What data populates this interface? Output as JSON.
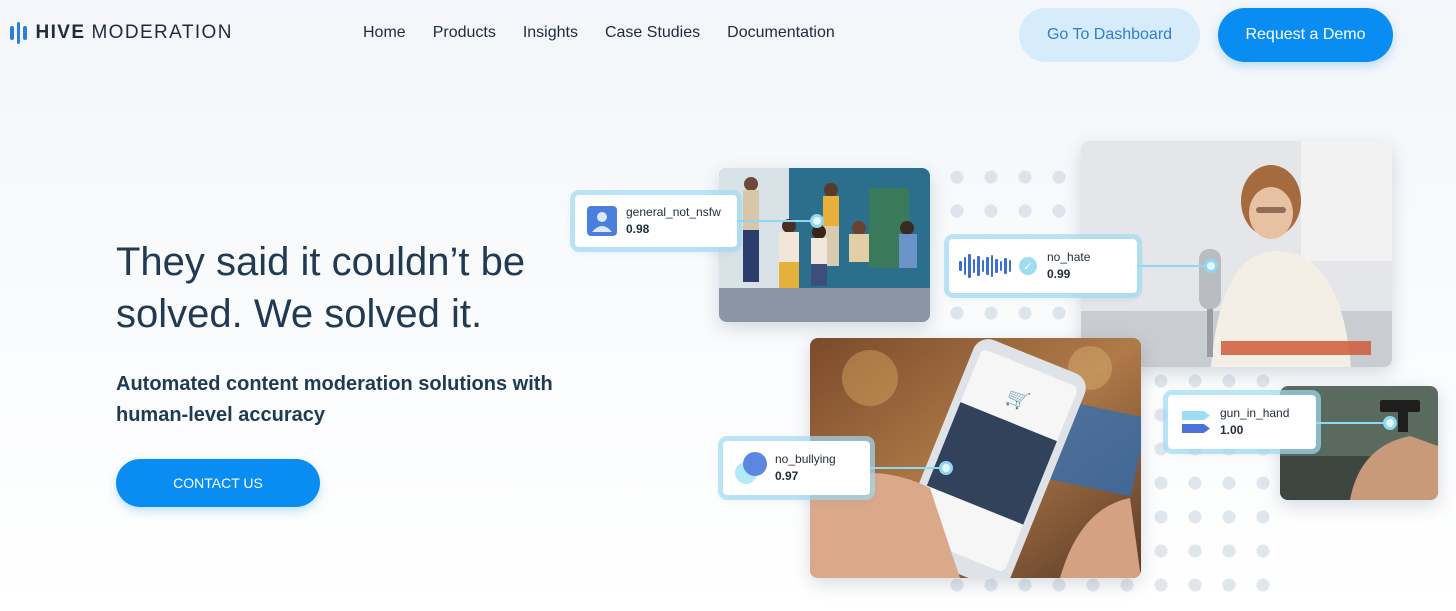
{
  "header": {
    "logo_bold": "HIVE",
    "logo_light": "MODERATION",
    "nav": [
      "Home",
      "Products",
      "Insights",
      "Case Studies",
      "Documentation"
    ],
    "dashboard_button": "Go To Dashboard",
    "demo_button": "Request a Demo"
  },
  "hero": {
    "headline": "They said it couldn’t be solved. We solved it.",
    "subhead": "Automated content moderation solutions with human-level accuracy",
    "cta": "CONTACT US"
  },
  "labels": {
    "nsfw": {
      "label": "general_not_nsfw",
      "score": "0.98"
    },
    "hate": {
      "label": "no_hate",
      "score": "0.99"
    },
    "bullying": {
      "label": "no_bullying",
      "score": "0.97"
    },
    "gun": {
      "label": "gun_in_hand",
      "score": "1.00"
    }
  },
  "colors": {
    "primary": "#0a8df2",
    "primary_light": "#d7ecfb",
    "heading": "#1f3a52",
    "accent_cyan": "#8fd8f3"
  },
  "icons": [
    "hive-logo-icon",
    "user-icon",
    "audio-wave-icon",
    "check-icon",
    "bubbles-icon",
    "flags-icon"
  ]
}
